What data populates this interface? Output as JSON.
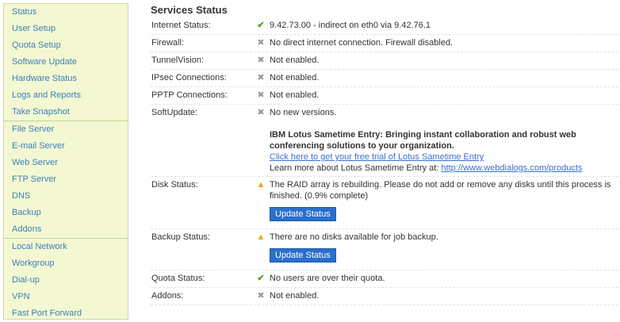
{
  "sidebar": {
    "groups": [
      [
        "Status",
        "User Setup",
        "Quota Setup",
        "Software Update",
        "Hardware Status",
        "Logs and Reports",
        "Take Snapshot"
      ],
      [
        "File Server",
        "E-mail Server",
        "Web Server",
        "FTP Server",
        "DNS",
        "Backup",
        "Addons"
      ],
      [
        "Local Network",
        "Workgroup",
        "Dial-up",
        "VPN",
        "Fast Port Forward"
      ]
    ]
  },
  "main": {
    "title": "Services Status",
    "rows": {
      "internet": {
        "label": "Internet Status:",
        "icon": "check-icon",
        "text": "9.42.73.00 - indirect on eth0 via 9.42.76.1"
      },
      "firewall": {
        "label": "Firewall:",
        "icon": "x-icon",
        "text": "No direct internet connection. Firewall disabled."
      },
      "tunnel": {
        "label": "TunnelVision:",
        "icon": "x-icon",
        "text": "Not enabled."
      },
      "ipsec": {
        "label": "IPsec Connections:",
        "icon": "x-icon",
        "text": "Not enabled."
      },
      "pptp": {
        "label": "PPTP Connections:",
        "icon": "x-icon",
        "text": "Not enabled."
      },
      "softupdate": {
        "label": "SoftUpdate:",
        "icon": "x-icon",
        "text": "No new versions.",
        "ad_title": "IBM Lotus Sametime Entry: Bringing instant collaboration and robust web conferencing solutions to your organization.",
        "ad_link": "Click here to get your free trial of Lotus Sametime Entry",
        "ad_learn_prefix": "Learn more about Lotus Sametime Entry at: ",
        "ad_learn_link": "http://www.webdialogs.com/products"
      },
      "disk": {
        "label": "Disk Status:",
        "icon": "warning-icon",
        "text": "The RAID array is rebuilding. Please do not add or remove any disks until this process is finished. (0.9% complete)",
        "button": "Update Status"
      },
      "backup": {
        "label": "Backup Status:",
        "icon": "warning-icon",
        "text": "There are no disks available for job backup.",
        "button": "Update Status"
      },
      "quota": {
        "label": "Quota Status:",
        "icon": "check-icon",
        "text": "No users are over their quota."
      },
      "addons": {
        "label": "Addons:",
        "icon": "x-icon",
        "text": "Not enabled."
      }
    }
  },
  "colors": {
    "sidebar_bg": "#f3f8d2",
    "link": "#3d7fb6",
    "button": "#2a6fcc",
    "check": "#4aa41d",
    "warning": "#e6a800"
  }
}
